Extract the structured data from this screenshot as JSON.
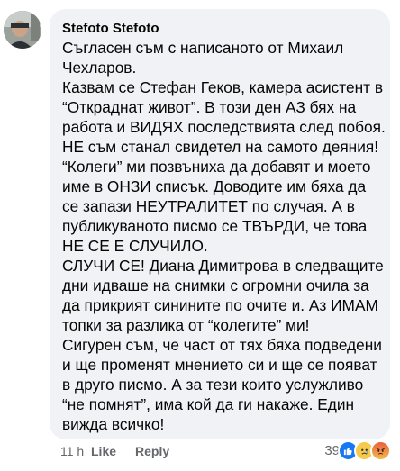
{
  "comment": {
    "author": "Stefoto Stefoto",
    "lines": [
      "Съгласен съм с написаното от Михаил",
      "Чехларов.",
      "Казвам се Стефан Геков, камера асистент в",
      "“Откраднат живот”. В този ден АЗ бях на",
      "работа и ВИДЯХ последствията след побоя.",
      "НЕ съм станал свидетел на самото деяния!",
      "“Колеги” ми позвъниха да добавят и моето",
      "име в ОНЗИ списък. Доводите им бяха да",
      "се запази НЕУТРАЛИТЕТ по случая. А в",
      "публикуваното писмо се ТВЪРДИ, че това",
      "НЕ СЕ Е СЛУЧИЛО.",
      "СЛУЧИ СЕ! Диана Димитрова в следващите",
      "дни идваше на снимки с огромни очила за",
      "да прикрият синините по очите и. Аз ИМАМ",
      "топки за разлика от “колегите” ми!",
      "Сигурен съм, че част от тях бяха подведени",
      "и ще променят мнението си и ще се появат",
      "в друго писмо. А за тези които услужливо",
      "“не помнят”, има кой да ги накаже. Един",
      "вижда всичко!"
    ]
  },
  "footer": {
    "time": "11 h",
    "like_label": "Like",
    "reply_label": "Reply"
  },
  "reactions": {
    "count": "39",
    "icons": [
      "like-icon",
      "sad-face-icon",
      "angry-face-icon"
    ]
  },
  "colors": {
    "bubble_bg": "#f0f2f5",
    "meta_text": "#65676b",
    "like_blue": "#1877f2"
  }
}
